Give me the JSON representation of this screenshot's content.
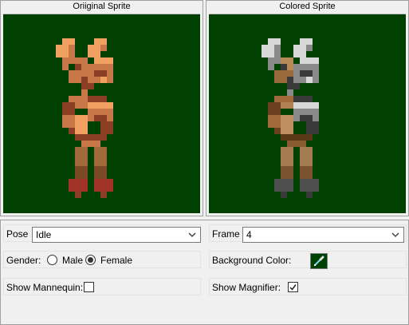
{
  "original_panel": {
    "title": "Oriiginal Sprite"
  },
  "colored_panel": {
    "title": "Colored Sprite"
  },
  "pose": {
    "label": "Pose",
    "value": "Idle"
  },
  "frame": {
    "label": "Frame",
    "value": "4"
  },
  "gender": {
    "label": "Gender:",
    "options": [
      "Male",
      "Female"
    ],
    "selected": "Female"
  },
  "background_color": {
    "label": "Background Color:",
    "value": "#004000",
    "icon": "eyedropper-icon"
  },
  "show_mannequin": {
    "label": "Show Mannequin:",
    "checked": false
  },
  "show_magnifier": {
    "label": "Show Magnifier:",
    "checked": true
  },
  "colors": {
    "canvas_bg": "#004000"
  }
}
